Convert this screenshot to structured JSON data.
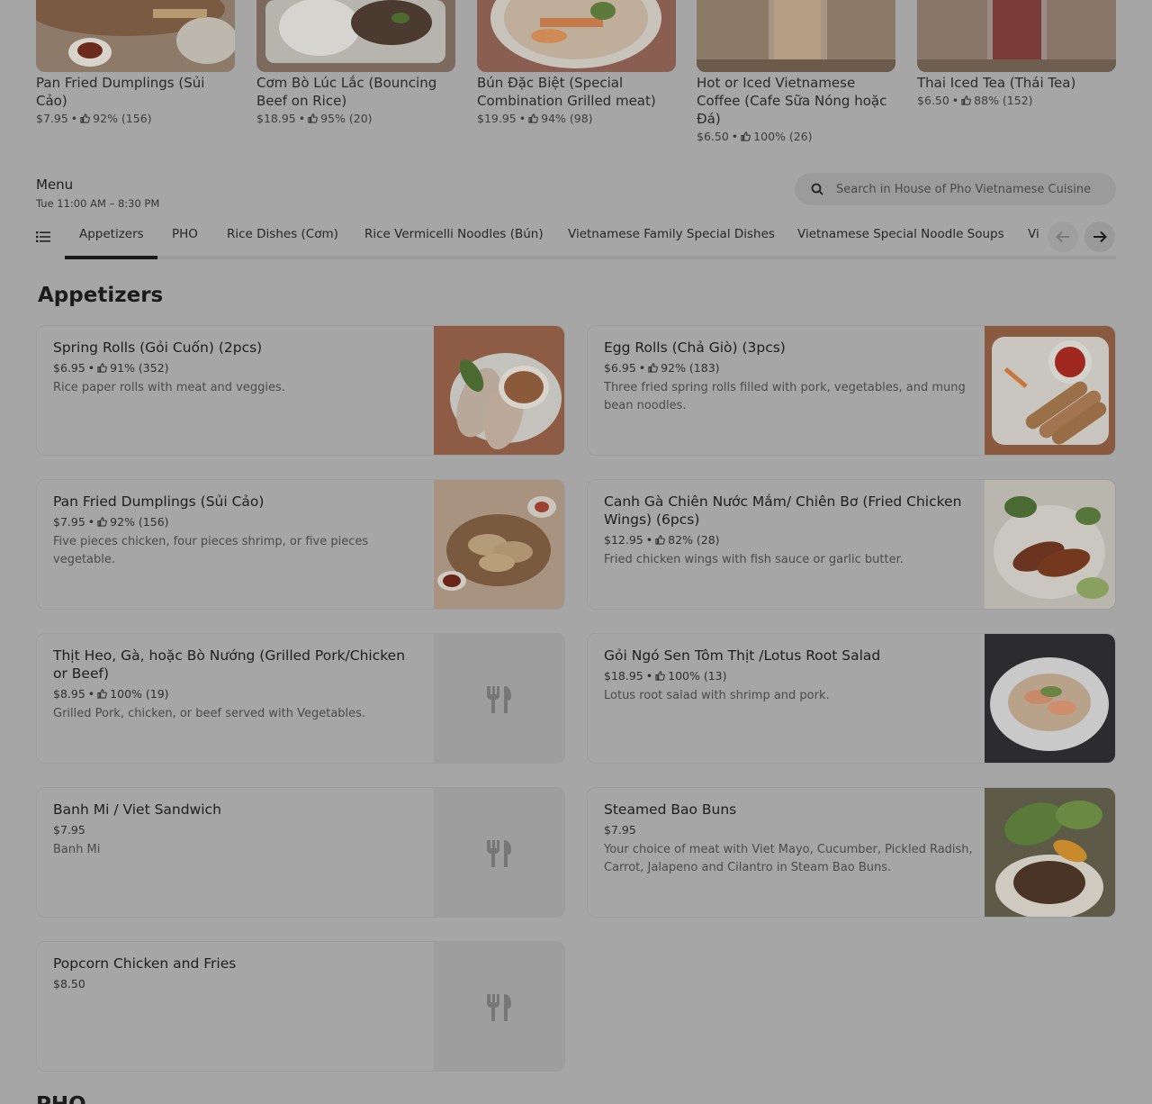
{
  "featured": [
    {
      "title": "Pan Fried Dumplings (Sủi Cảo)",
      "price": "$7.95",
      "rating": "92% (156)"
    },
    {
      "title": "Cơm Bò Lúc Lắc (Bouncing Beef on Rice)",
      "price": "$18.95",
      "rating": "95% (20)"
    },
    {
      "title": "Bún Đặc Biệt (Special Combination Grilled meat)",
      "price": "$19.95",
      "rating": "94% (98)"
    },
    {
      "title": "Hot or Iced Vietnamese Coffee (Cafe Sữa Nóng hoặc Đá)",
      "price": "$6.50",
      "rating": "100% (26)"
    },
    {
      "title": "Thai Iced Tea (Thái Tea)",
      "price": "$6.50",
      "rating": "88% (152)"
    }
  ],
  "menu": {
    "title": "Menu",
    "hours": "Tue 11:00 AM – 8:30 PM",
    "search_placeholder": "Search in House of Pho Vietnamese Cuisine"
  },
  "tabs": [
    "Appetizers",
    "PHO",
    "Rice Dishes (Cơm)",
    "Rice Vermicelli Noodles (Bún)",
    "Vietnamese Family Special Dishes",
    "Vietnamese Special Noodle Soups",
    "Vietnamese"
  ],
  "section": {
    "title": "Appetizers",
    "next_title": "PHO"
  },
  "items": [
    {
      "name": "Spring Rolls (Gỏi Cuốn) (2pcs)",
      "price": "$6.95",
      "rating": "91% (352)",
      "desc": "Rice paper rolls with meat and veggies."
    },
    {
      "name": "Egg Rolls (Chả Giò) (3pcs)",
      "price": "$6.95",
      "rating": "92% (183)",
      "desc": "Three fried spring rolls filled with pork, vegetables, and mung bean noodles."
    },
    {
      "name": "Pan Fried Dumplings (Sủi Cảo)",
      "price": "$7.95",
      "rating": "92% (156)",
      "desc": "Five pieces chicken, four pieces shrimp, or five pieces vegetable."
    },
    {
      "name": "Canh Gà Chiên Nước Mắm/ Chiên Bơ (Fried Chicken Wings) (6pcs)",
      "price": "$12.95",
      "rating": "82% (28)",
      "desc": "Fried chicken wings with fish sauce or garlic butter."
    },
    {
      "name": "Thịt Heo, Gà, hoặc Bò Nướng (Grilled Pork/Chicken or Beef)",
      "price": "$8.95",
      "rating": "100% (19)",
      "desc": "Grilled Pork, chicken, or beef served with Vegetables."
    },
    {
      "name": "Gỏi Ngó Sen Tôm Thịt /Lotus Root Salad",
      "price": "$18.95",
      "rating": "100% (13)",
      "desc": "Lotus root salad with shrimp and pork."
    },
    {
      "name": "Banh Mi / Viet Sandwich",
      "price": "$7.95",
      "desc": "Banh Mi"
    },
    {
      "name": "Steamed Bao Buns",
      "price": "$7.95",
      "desc": "Your choice of meat with Viet Mayo, Cucumber, Pickled Radish, Carrot, Jalapeno and Cilantro in Steam Bao Buns."
    },
    {
      "name": "Popcorn Chicken and Fries",
      "price": "$8.50"
    }
  ],
  "meta_separator": "•",
  "colors": {
    "overlay_bg": "#a6a6a6",
    "text": "#1e1e1e",
    "tab_active": "#1a1a1a"
  }
}
